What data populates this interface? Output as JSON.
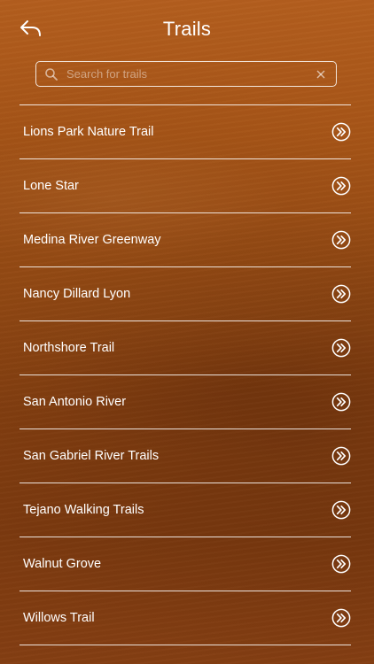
{
  "header": {
    "title": "Trails",
    "back_icon": "back-arrow-icon"
  },
  "search": {
    "placeholder": "Search for trails",
    "value": "",
    "icon": "search-icon",
    "clear_icon": "clear-icon"
  },
  "trails": [
    {
      "name": "Lions Park Nature Trail"
    },
    {
      "name": "Lone Star"
    },
    {
      "name": "Medina River Greenway"
    },
    {
      "name": "Nancy Dillard Lyon"
    },
    {
      "name": "Northshore Trail"
    },
    {
      "name": "San Antonio River"
    },
    {
      "name": "San Gabriel River Trails"
    },
    {
      "name": "Tejano Walking Trails"
    },
    {
      "name": "Walnut Grove"
    },
    {
      "name": "Willows Trail"
    }
  ],
  "row_icon": "double-chevron-right-icon",
  "colors": {
    "background_top": "#b35e1e",
    "background_bottom": "#7c3a0f",
    "foreground": "#ffffff"
  }
}
